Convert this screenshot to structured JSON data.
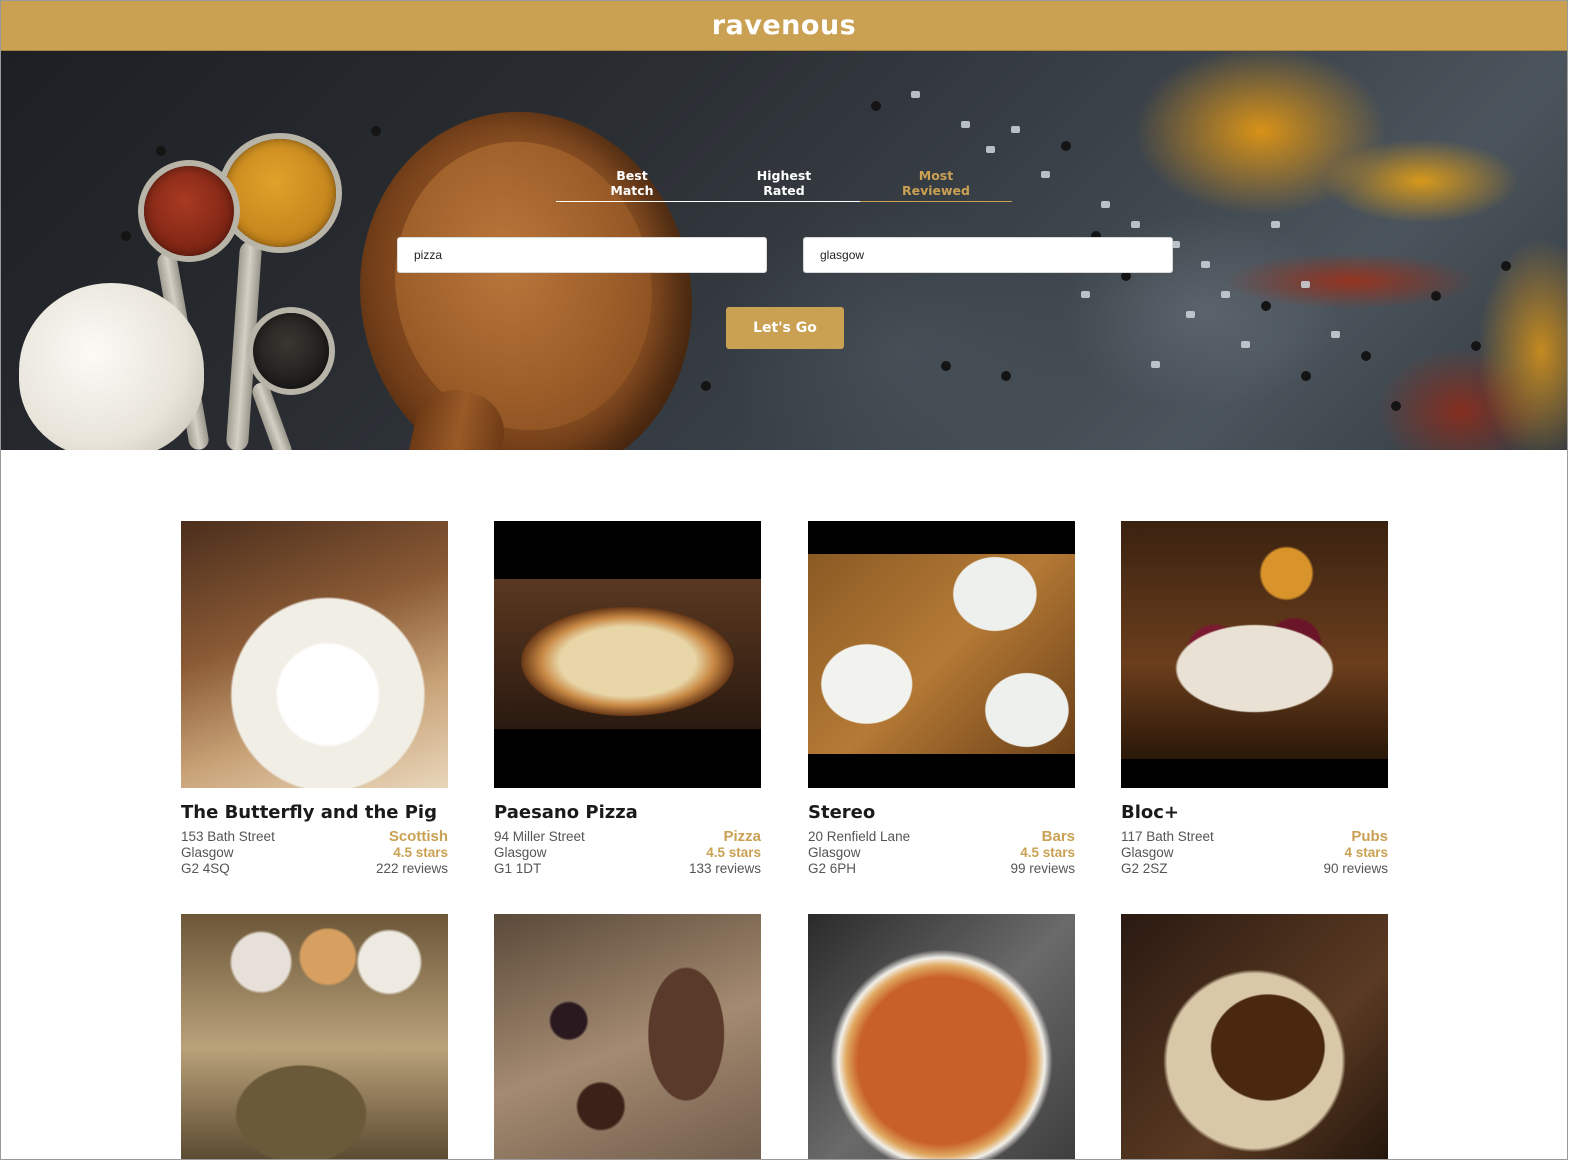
{
  "app": {
    "brand": "ravenous"
  },
  "sort_options": [
    {
      "line1": "Best",
      "line2": "Match"
    },
    {
      "line1": "Highest",
      "line2": "Rated"
    },
    {
      "line1": "Most",
      "line2": "Reviewed"
    }
  ],
  "active_sort_index": 2,
  "search": {
    "term_value": "pizza",
    "location_value": "glasgow",
    "submit_label": "Let's Go"
  },
  "businesses": [
    {
      "name": "The Butterfly and the Pig",
      "address": "153 Bath Street",
      "city": "Glasgow",
      "postcode": "G2 4SQ",
      "category": "Scottish",
      "rating": "4.5 stars",
      "reviews": "222 reviews"
    },
    {
      "name": "Paesano Pizza",
      "address": "94 Miller Street",
      "city": "Glasgow",
      "postcode": "G1 1DT",
      "category": "Pizza",
      "rating": "4.5 stars",
      "reviews": "133 reviews"
    },
    {
      "name": "Stereo",
      "address": "20 Renfield Lane",
      "city": "Glasgow",
      "postcode": "G2 6PH",
      "category": "Bars",
      "rating": "4.5 stars",
      "reviews": "99 reviews"
    },
    {
      "name": "Bloc+",
      "address": "117 Bath Street",
      "city": "Glasgow",
      "postcode": "G2 2SZ",
      "category": "Pubs",
      "rating": "4 stars",
      "reviews": "90 reviews"
    },
    {
      "name": "",
      "address": "",
      "city": "",
      "postcode": "",
      "category": "",
      "rating": "",
      "reviews": ""
    },
    {
      "name": "",
      "address": "",
      "city": "",
      "postcode": "",
      "category": "",
      "rating": "",
      "reviews": ""
    },
    {
      "name": "",
      "address": "",
      "city": "",
      "postcode": "",
      "category": "",
      "rating": "",
      "reviews": ""
    },
    {
      "name": "",
      "address": "",
      "city": "",
      "postcode": "",
      "category": "",
      "rating": "",
      "reviews": ""
    }
  ],
  "colors": {
    "accent": "#caa153",
    "text": "#1a1a1a",
    "muted": "#555555"
  }
}
